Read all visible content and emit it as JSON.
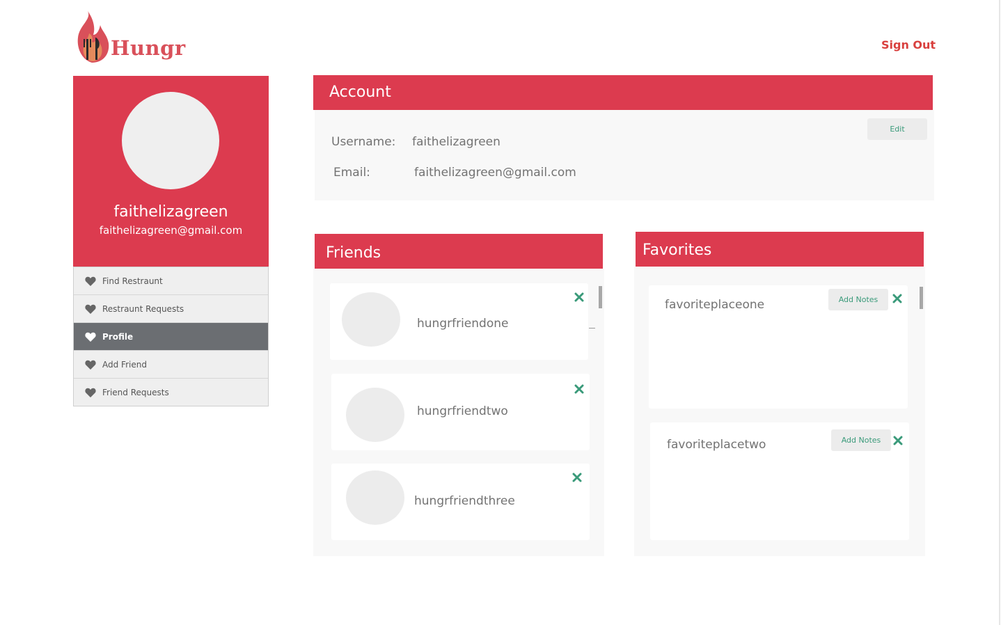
{
  "header": {
    "logo_text": "Hungr",
    "sign_out_label": "Sign Out"
  },
  "profile": {
    "username": "faithelizagreen",
    "email": "faithelizagreen@gmail.com"
  },
  "nav": {
    "items": [
      {
        "label": "Find Restraunt",
        "icon": "heart-icon"
      },
      {
        "label": "Restraunt Requests",
        "icon": "heart-icon"
      },
      {
        "label": "Profile",
        "icon": "heart-icon",
        "active": true
      },
      {
        "label": "Add Friend",
        "icon": "heart-icon"
      },
      {
        "label": "Friend Requests",
        "icon": "heart-icon"
      }
    ]
  },
  "account": {
    "title": "Account",
    "edit_label": "Edit",
    "username_label": "Username:",
    "username_value": "faithelizagreen",
    "email_label": "Email:",
    "email_value": "faithelizagreen@gmail.com"
  },
  "friends": {
    "title": "Friends",
    "items": [
      {
        "name": "hungrfriendone"
      },
      {
        "name": "hungrfriendtwo"
      },
      {
        "name": "hungrfriendthree"
      }
    ]
  },
  "favorites": {
    "title": "Favorites",
    "add_notes_label": "Add Notes",
    "items": [
      {
        "name": "favoriteplaceone"
      },
      {
        "name": "favoriteplacetwo"
      }
    ]
  },
  "colors": {
    "brand_red": "#dc3b4f",
    "accent_green": "#3a9a7a",
    "sign_out": "#d9413f"
  }
}
